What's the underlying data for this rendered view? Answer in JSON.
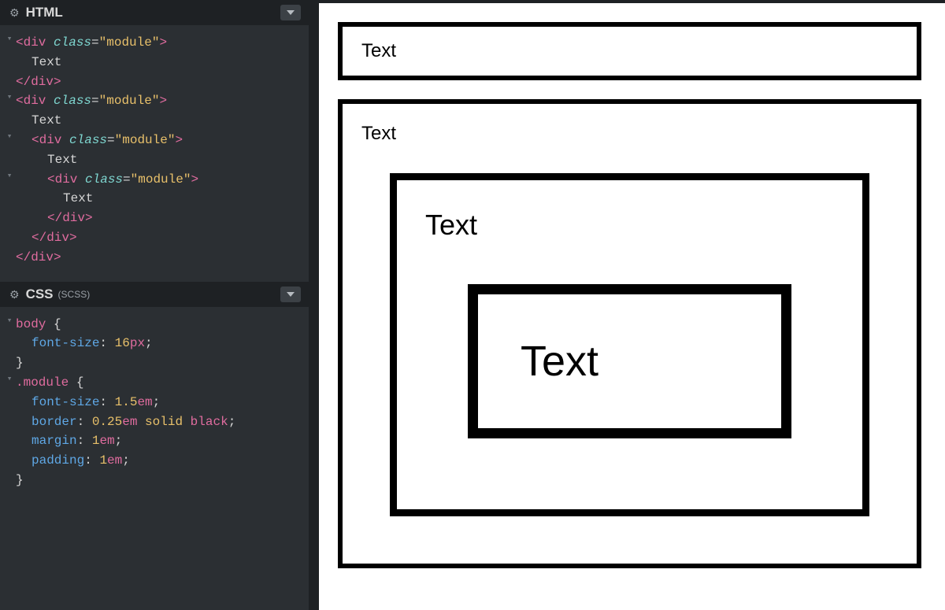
{
  "panes": {
    "html": {
      "title": "HTML",
      "subtitle": ""
    },
    "css": {
      "title": "CSS",
      "subtitle": "(SCSS)"
    }
  },
  "html_code": {
    "tag_div_open": "<div",
    "class_attr": "class",
    "eq": "=",
    "module_str": "\"module\"",
    "close_gt": ">",
    "text": "Text",
    "tag_div_close": "</div>"
  },
  "css_code": {
    "sel_body": "body",
    "sel_module": ".module",
    "brace_open": "{",
    "brace_close": "}",
    "props": {
      "font_size": "font-size",
      "border": "border",
      "margin": "margin",
      "padding": "padding"
    },
    "vals": {
      "body_fs_num": "16",
      "body_fs_unit": "px",
      "module_fs_num": "1.5",
      "module_fs_unit": "em",
      "border_num": "0.25",
      "border_unit": "em",
      "border_style": "solid",
      "border_color": "black",
      "margin_num": "1",
      "margin_unit": "em",
      "padding_num": "1",
      "padding_unit": "em"
    },
    "colon": ":",
    "semicolon": ";"
  },
  "preview": {
    "text": "Text"
  }
}
